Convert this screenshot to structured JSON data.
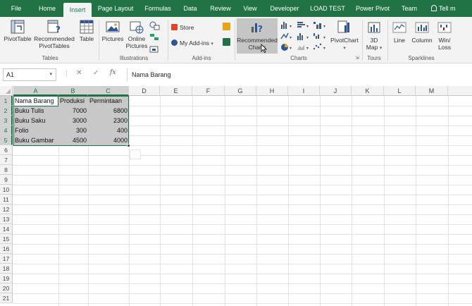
{
  "ribbon_tabs": [
    {
      "label": "File",
      "active": false
    },
    {
      "label": "Home",
      "active": false
    },
    {
      "label": "Insert",
      "active": true
    },
    {
      "label": "Page Layout",
      "active": false
    },
    {
      "label": "Formulas",
      "active": false
    },
    {
      "label": "Data",
      "active": false
    },
    {
      "label": "Review",
      "active": false
    },
    {
      "label": "View",
      "active": false
    },
    {
      "label": "Developer",
      "active": false
    },
    {
      "label": "LOAD TEST",
      "active": false
    },
    {
      "label": "Power Pivot",
      "active": false
    },
    {
      "label": "Team",
      "active": false
    },
    {
      "label": "Tell m",
      "active": false
    }
  ],
  "ribbon": {
    "tables": {
      "pivottable": "PivotTable",
      "recommended_pivottables_line1": "Recommended",
      "recommended_pivottables_line2": "PivotTables",
      "table": "Table",
      "label": "Tables"
    },
    "illustrations": {
      "pictures": "Pictures",
      "online_pictures_line1": "Online",
      "online_pictures_line2": "Pictures",
      "label": "Illustrations"
    },
    "addins": {
      "store": "Store",
      "my_addins": "My Add-ins",
      "label": "Add-ins"
    },
    "charts": {
      "recommended_charts_line1": "Recommended",
      "recommended_charts_line2": "Charts",
      "pivotchart": "PivotChart",
      "label": "Charts"
    },
    "tours": {
      "map_line1": "3D",
      "map_line2": "Map",
      "label": "Tours"
    },
    "sparklines": {
      "line": "Line",
      "column": "Column",
      "winloss_line1": "Win/",
      "winloss_line2": "Loss",
      "label": "Sparklines"
    }
  },
  "formula_bar": {
    "name_box": "A1",
    "fx": "fx",
    "cancel": "✕",
    "enter": "✓",
    "content": "Nama Barang"
  },
  "grid": {
    "columns": [
      "A",
      "B",
      "C",
      "D",
      "E",
      "F",
      "G",
      "H",
      "I",
      "J",
      "K",
      "L",
      "M"
    ],
    "rows": [
      "1",
      "2",
      "3",
      "4",
      "5",
      "6",
      "7",
      "8",
      "9",
      "10",
      "11",
      "12",
      "13",
      "14",
      "15",
      "16",
      "17",
      "18",
      "19",
      "20",
      "21"
    ],
    "headers": [
      "Nama Barang",
      "Produksi",
      "Permintaan"
    ],
    "data": [
      [
        "Buku Tulis",
        "7000",
        "6800"
      ],
      [
        "Buku Saku",
        "3000",
        "2300"
      ],
      [
        "Folio",
        "300",
        "400"
      ],
      [
        "Buku Gambar",
        "4500",
        "4000"
      ]
    ]
  },
  "colors": {
    "accent": "#217346",
    "ribbon_bg": "#f3f3f3",
    "selection_fill": "#c8c8c8"
  }
}
